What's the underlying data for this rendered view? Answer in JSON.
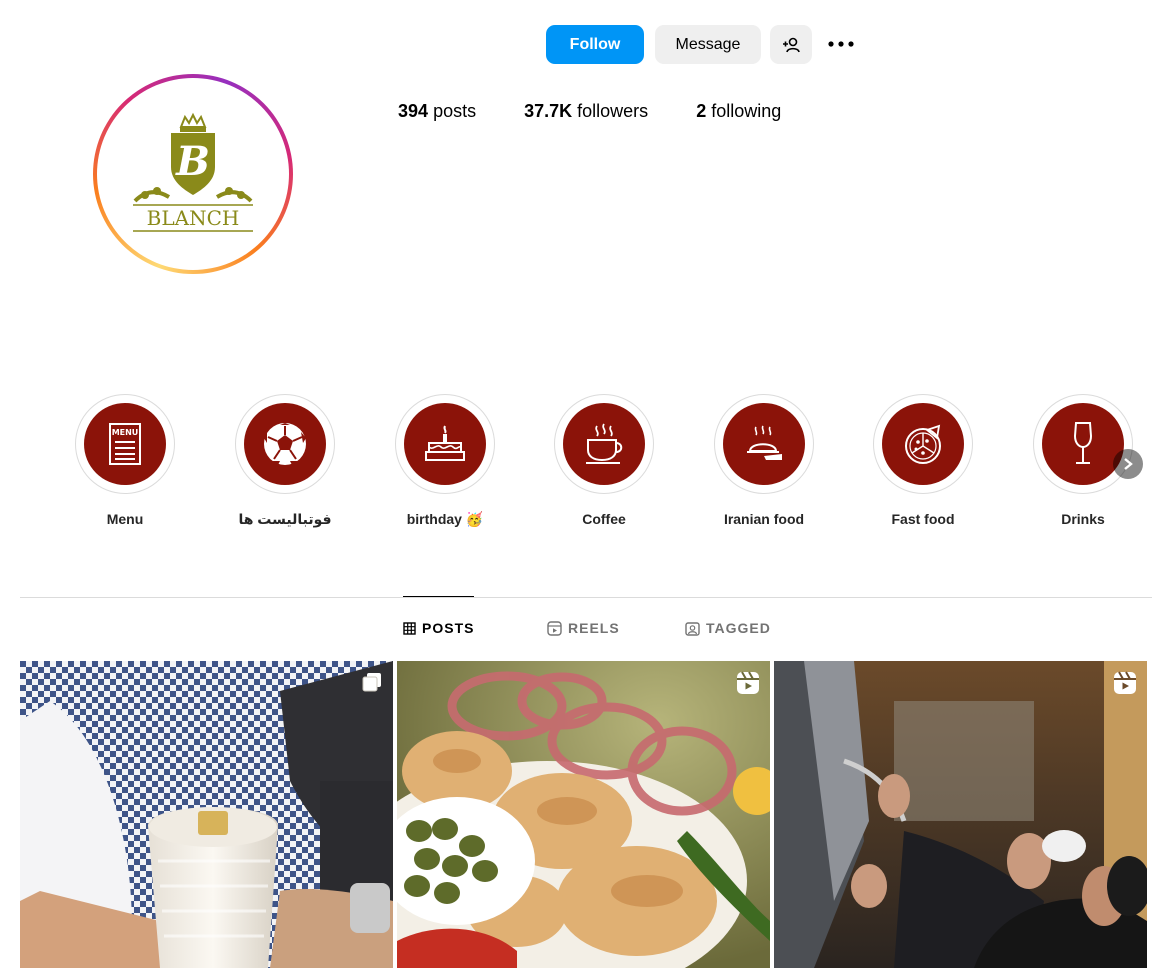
{
  "header": {
    "follow_label": "Follow",
    "message_label": "Message"
  },
  "profile": {
    "logo_text": "BLANCH",
    "logo_letter": "B"
  },
  "stats": {
    "posts_count": "394",
    "posts_label": "posts",
    "followers_count": "37.7K",
    "followers_label": "followers",
    "following_count": "2",
    "following_label": "following"
  },
  "highlights": [
    {
      "label": "Menu",
      "icon": "menu-icon"
    },
    {
      "label": "فوتبالیست ها",
      "icon": "soccer-ball-icon"
    },
    {
      "label": "birthday 🥳",
      "icon": "cake-icon"
    },
    {
      "label": "Coffee",
      "icon": "coffee-cup-icon"
    },
    {
      "label": "Iranian food",
      "icon": "cloche-icon"
    },
    {
      "label": "Fast food",
      "icon": "pizza-icon"
    },
    {
      "label": "Drinks",
      "icon": "wine-glass-icon"
    }
  ],
  "tabs": [
    {
      "label": "POSTS",
      "icon": "grid-icon",
      "active": true
    },
    {
      "label": "REELS",
      "icon": "reels-icon",
      "active": false
    },
    {
      "label": "TAGGED",
      "icon": "tagged-icon",
      "active": false
    }
  ],
  "posts": [
    {
      "type": "carousel",
      "subject": "milkshake-drink"
    },
    {
      "type": "reel",
      "subject": "kebab-platter"
    },
    {
      "type": "reel",
      "subject": "chefs-in-kitchen"
    }
  ],
  "colors": {
    "accent": "#0095f6",
    "highlight_bg": "#8b1309",
    "logo_olive": "#8a8a1a"
  }
}
